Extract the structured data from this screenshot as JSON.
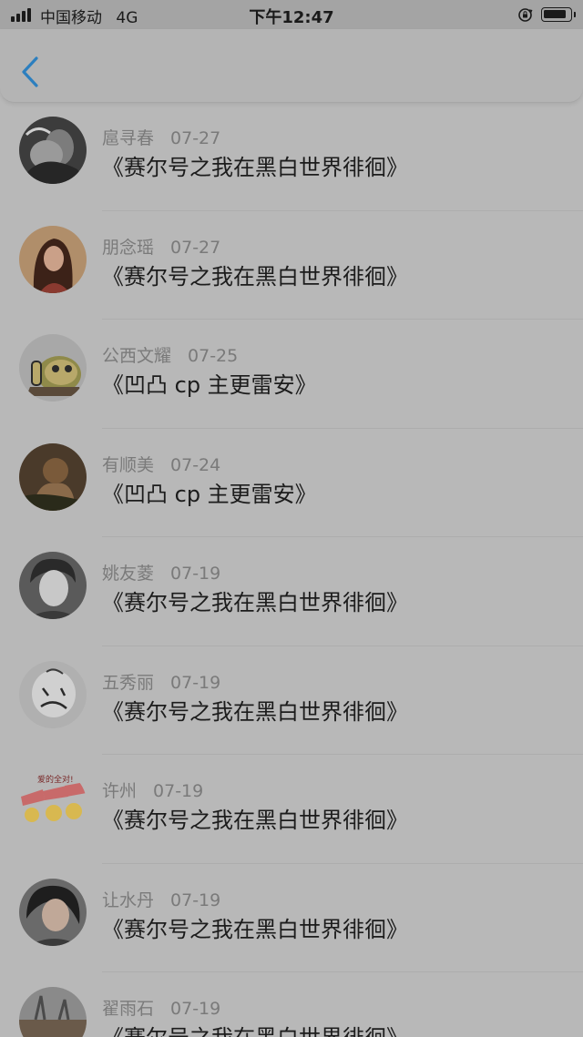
{
  "status_bar": {
    "carrier": "中国移动",
    "network": "4G",
    "time": "下午12:47",
    "signal_bars": 4,
    "battery_level": 0.9,
    "icons": [
      "signal-icon",
      "rotation-lock-icon",
      "battery-icon"
    ]
  },
  "nav": {
    "back_icon": "chevron-left-icon",
    "accent_color": "#2c7fbf"
  },
  "items": [
    {
      "name": "扈寻春",
      "date": "07-27",
      "title": "《赛尔号之我在黑白世界徘徊》"
    },
    {
      "name": "朋念瑶",
      "date": "07-27",
      "title": "《赛尔号之我在黑白世界徘徊》"
    },
    {
      "name": "公西文耀",
      "date": "07-25",
      "title": "《凹凸 cp 主更雷安》"
    },
    {
      "name": "有顺美",
      "date": "07-24",
      "title": "《凹凸 cp 主更雷安》"
    },
    {
      "name": "姚友菱",
      "date": "07-19",
      "title": "《赛尔号之我在黑白世界徘徊》"
    },
    {
      "name": "五秀丽",
      "date": "07-19",
      "title": "《赛尔号之我在黑白世界徘徊》"
    },
    {
      "name": "许州",
      "date": "07-19",
      "title": "《赛尔号之我在黑白世界徘徊》"
    },
    {
      "name": "让水丹",
      "date": "07-19",
      "title": "《赛尔号之我在黑白世界徘徊》"
    },
    {
      "name": "翟雨石",
      "date": "07-19",
      "title": "《赛尔号之我在黑白世界徘徊》"
    }
  ]
}
